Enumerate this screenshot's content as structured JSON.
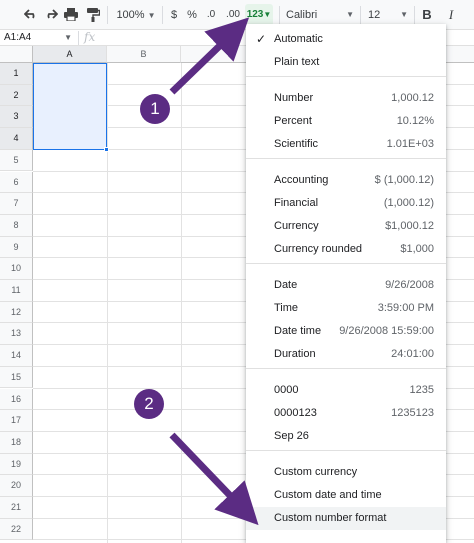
{
  "toolbar": {
    "zoom": "100%",
    "currency_symbol": "$",
    "percent_symbol": "%",
    "decrease_decimal": ".0",
    "increase_decimal": ".00",
    "more_formats": "123",
    "font": "Calibri",
    "font_size": "12",
    "bold": "B",
    "italic": "I"
  },
  "formula_bar": {
    "name_box": "A1:A4",
    "fx": "fx"
  },
  "grid": {
    "columns": [
      "A",
      "B"
    ],
    "rows": [
      "1",
      "2",
      "3",
      "4",
      "5",
      "6",
      "7",
      "8",
      "9",
      "10",
      "11",
      "12",
      "13",
      "14",
      "15",
      "16",
      "17",
      "18",
      "19",
      "20",
      "21",
      "22"
    ]
  },
  "menu": {
    "items": [
      {
        "label": "Automatic",
        "value": ""
      },
      {
        "label": "Plain text",
        "value": ""
      },
      {
        "label": "Number",
        "value": "1,000.12"
      },
      {
        "label": "Percent",
        "value": "10.12%"
      },
      {
        "label": "Scientific",
        "value": "1.01E+03"
      },
      {
        "label": "Accounting",
        "value": "$ (1,000.12)"
      },
      {
        "label": "Financial",
        "value": "(1,000.12)"
      },
      {
        "label": "Currency",
        "value": "$1,000.12"
      },
      {
        "label": "Currency rounded",
        "value": "$1,000"
      },
      {
        "label": "Date",
        "value": "9/26/2008"
      },
      {
        "label": "Time",
        "value": "3:59:00 PM"
      },
      {
        "label": "Date time",
        "value": "9/26/2008 15:59:00"
      },
      {
        "label": "Duration",
        "value": "24:01:00"
      },
      {
        "label": "0000",
        "value": "1235"
      },
      {
        "label": "0000123",
        "value": "1235123"
      },
      {
        "label": "Sep 26",
        "value": ""
      },
      {
        "label": "Custom currency",
        "value": ""
      },
      {
        "label": "Custom date and time",
        "value": ""
      },
      {
        "label": "Custom number format",
        "value": ""
      }
    ]
  },
  "annotations": {
    "badge1": "1",
    "badge2": "2",
    "color": "#5b2c83"
  }
}
